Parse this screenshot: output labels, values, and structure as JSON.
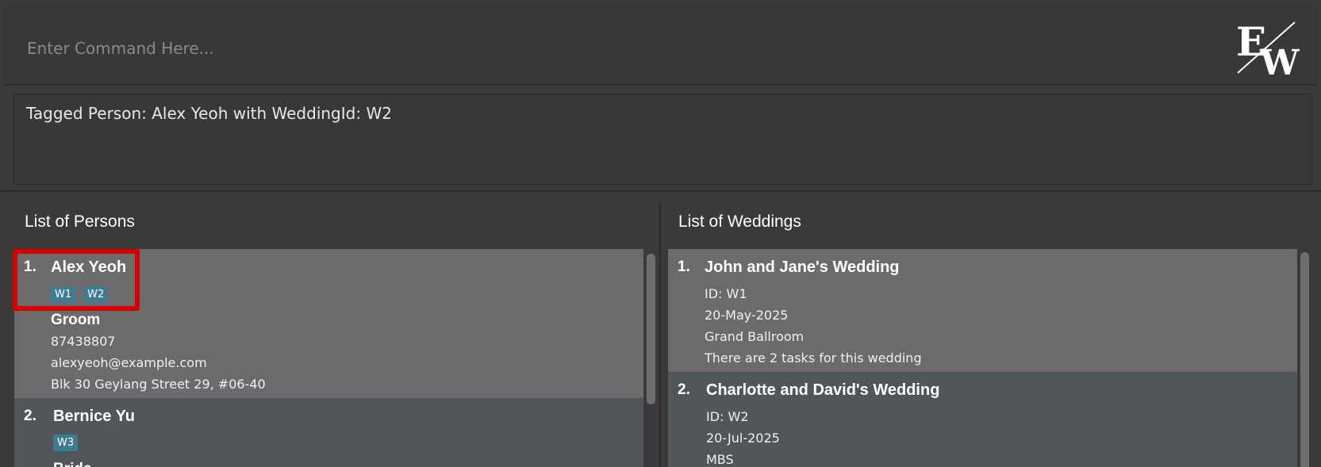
{
  "command": {
    "placeholder": "Enter Command Here..."
  },
  "logo": {
    "letter1": "E",
    "letter2": "W"
  },
  "result": {
    "text": "Tagged Person: Alex Yeoh with WeddingId: W2"
  },
  "persons": {
    "title": "List of Persons",
    "items": [
      {
        "index": "1.",
        "name": "Alex Yeoh",
        "tags": [
          "W1",
          "W2"
        ],
        "role": "Groom",
        "phone": "87438807",
        "email": "alexyeoh@example.com",
        "address": "Blk 30 Geylang Street 29, #06-40"
      },
      {
        "index": "2.",
        "name": "Bernice Yu",
        "tags": [
          "W3"
        ],
        "role": "Bride"
      }
    ]
  },
  "weddings": {
    "title": "List of Weddings",
    "items": [
      {
        "index": "1.",
        "name": "John and Jane's Wedding",
        "id": "ID: W1",
        "date": "20-May-2025",
        "venue": "Grand Ballroom",
        "tasks": "There are 2 tasks for this wedding"
      },
      {
        "index": "2.",
        "name": "Charlotte and David's Wedding",
        "id": "ID: W2",
        "date": "20-Jul-2025",
        "venue": "MBS"
      }
    ]
  },
  "colors": {
    "background": "#3a3a3a",
    "selected_card": "#6b6b6b",
    "card": "#515659",
    "tag": "#3e7b91",
    "highlight": "#d40000"
  }
}
